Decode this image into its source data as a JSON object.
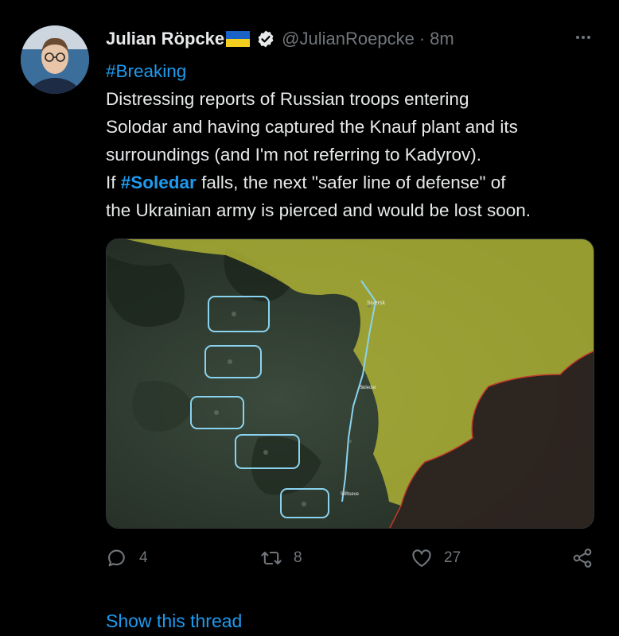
{
  "tweet": {
    "author_name": "Julian Röpcke",
    "handle": "@JulianRoepcke",
    "separator": "·",
    "time": "8m",
    "text": {
      "hashtag_breaking": "#Breaking",
      "line2": "Distressing reports of Russian troops entering",
      "line3": "Solodar and having captured the Knauf plant and its",
      "line4": "surroundings (and I'm not referring to Kadyrov).",
      "line5_pre": "If ",
      "line5_tag": "#Soledar",
      "line5_post": " falls, the next \"safer line of defense\" of",
      "line6": "the Ukrainian army is pierced and would be lost soon."
    },
    "icons": {
      "verified": "verified-badge-icon",
      "flag": "ukraine-flag-icon",
      "more": "more-icon",
      "reply": "reply-icon",
      "retweet": "retweet-icon",
      "like": "like-icon",
      "share": "share-icon"
    },
    "map": {
      "labels": {
        "siversk": "Siversk",
        "soledar": "Soledar",
        "soltseve": "Soltseve"
      }
    },
    "actions": {
      "replies": "4",
      "retweets": "8",
      "likes": "27"
    },
    "show_thread": "Show this thread"
  },
  "colors": {
    "background": "#000000",
    "text": "#e7e9ea",
    "muted": "#71767b",
    "accent": "#1d9bf0",
    "flag_blue": "#1a62c6",
    "flag_yellow": "#f2cf1e",
    "map_yellow_zone": "#c9cc3e",
    "map_red_border": "#c23a2a",
    "map_cyan": "#8ad3f0"
  }
}
